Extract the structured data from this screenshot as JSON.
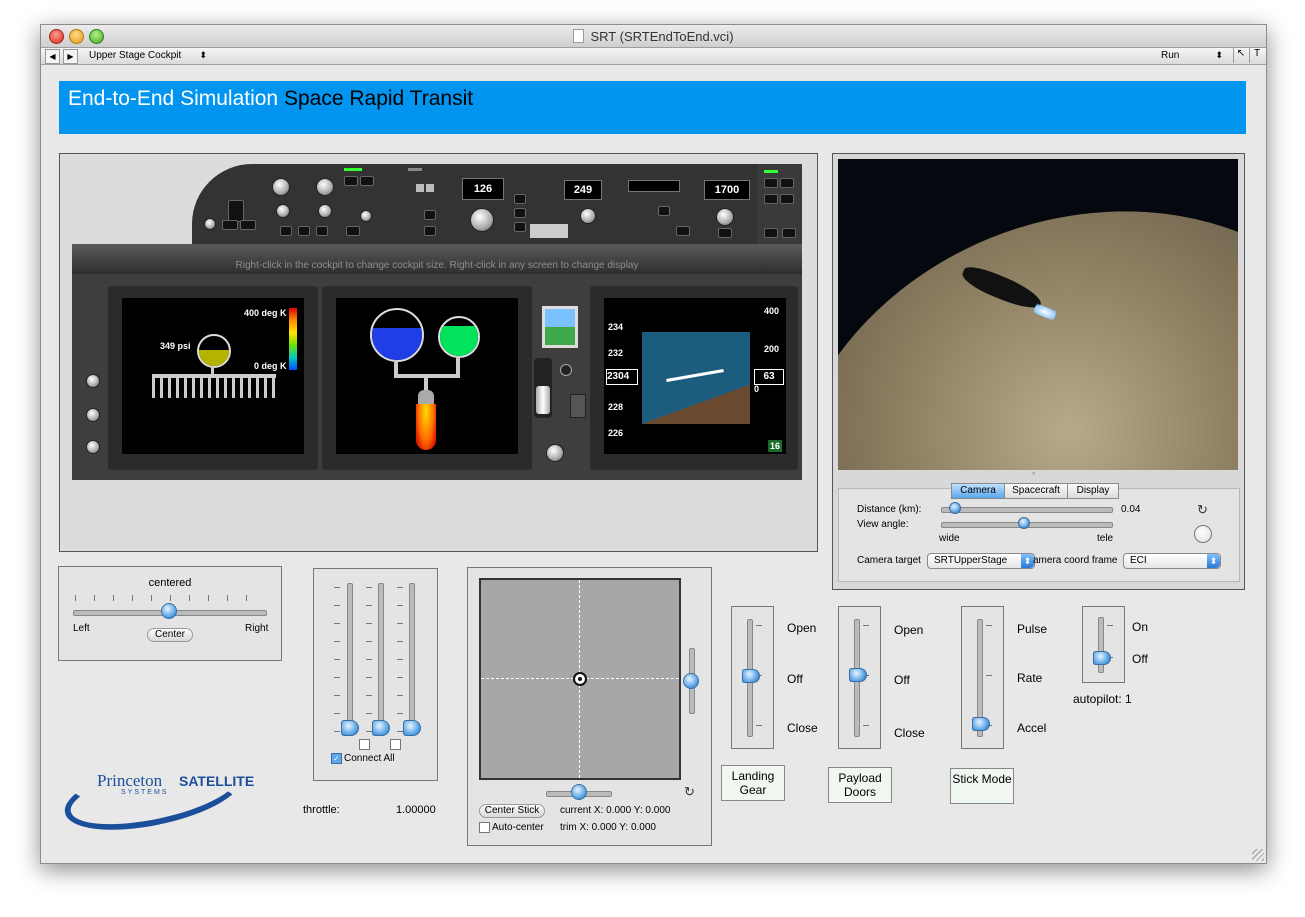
{
  "window": {
    "title": "SRT (SRTEndToEnd.vci)"
  },
  "toolbar": {
    "view_select": "Upper Stage Cockpit",
    "run_select": "Run"
  },
  "banner": {
    "title_white": "End-to-End Simulation",
    "title_black": "Space Rapid Transit"
  },
  "cockpit": {
    "hint": "Right-click in the cockpit to change cockpit size. Right-click in any screen to change display",
    "display_126": "126",
    "display_249": "249",
    "display_1700": "1700",
    "pressure": "349 psi",
    "temp_high": "400 deg K",
    "temp_low": "0 deg K",
    "pfd": {
      "speed_ticks": [
        "234",
        "232",
        "228",
        "226"
      ],
      "speed_value": "2304",
      "alt_ticks": [
        "400",
        "200",
        "0"
      ],
      "alt_value": "63",
      "badge": "16"
    }
  },
  "camera": {
    "tabs": [
      "Camera",
      "Spacecraft",
      "Display"
    ],
    "active_tab": "Camera",
    "distance_label": "Distance (km):",
    "distance_value": "0.04",
    "distance_level": 0.05,
    "view_angle_label": "View angle:",
    "view_angle_level": 0.48,
    "wide": "wide",
    "tele": "tele",
    "target_label": "Camera target",
    "target_value": "SRTUpperStage",
    "frame_label": "amera coord frame",
    "frame_value": "ECI"
  },
  "rudder": {
    "status": "centered",
    "left": "Left",
    "right": "Right",
    "center_button": "Center",
    "level": 0.5
  },
  "throttle": {
    "connect_all": "Connect All",
    "connect_all_checked": true,
    "label": "throttle:",
    "value": "1.00000"
  },
  "stick": {
    "center_button": "Center Stick",
    "current": "current X: 0.000  Y: 0.000",
    "auto_center": "Auto-center",
    "trim": "trim X: 0.000  Y: 0.000"
  },
  "landing_gear": {
    "open": "Open",
    "off": "Off",
    "close": "Close",
    "button": "Landing Gear"
  },
  "payload_doors": {
    "open": "Open",
    "off": "Off",
    "close": "Close",
    "button": "Payload Doors"
  },
  "stick_mode": {
    "pulse": "Pulse",
    "rate": "Rate",
    "accel": "Accel",
    "button": "Stick Mode"
  },
  "autopilot": {
    "on": "On",
    "off": "Off",
    "status": "autopilot: 1"
  },
  "logo": {
    "text_a": "Princeton",
    "text_b": "SATELLITE",
    "text_c": "SYSTEMS"
  },
  "colors": {
    "banner": "#0195f0",
    "tank_blue": "#1f3ee8",
    "tank_green": "#00e35a",
    "tank_yellow": "#b3b300"
  }
}
